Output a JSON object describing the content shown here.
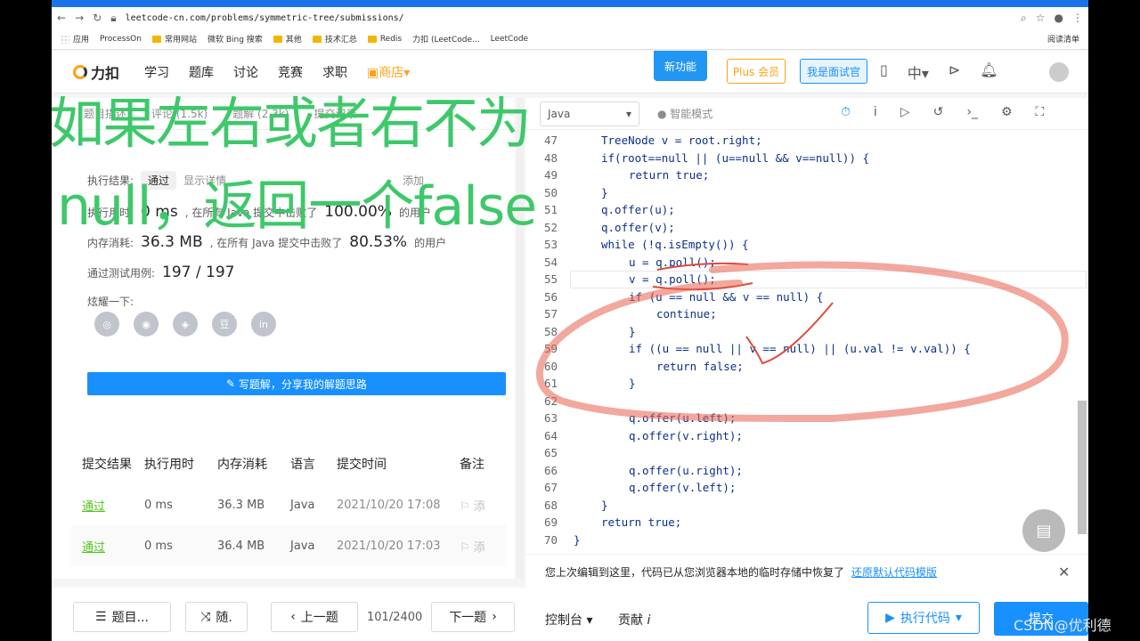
{
  "browser": {
    "url": "leetcode-cn.com/problems/symmetric-tree/submissions/",
    "bookmarks": [
      "应用",
      "ProcessOn",
      "常用网站",
      "微软 Bing 搜索",
      "其他",
      "技术汇总",
      "Redis",
      "力扣 (LeetCode...",
      "LeetCode"
    ],
    "reading_list": "阅读清单"
  },
  "nav": {
    "logo": "力扣",
    "items": [
      "学习",
      "题库",
      "讨论",
      "竞赛",
      "求职"
    ],
    "store": "商店",
    "new_feature": "新功能",
    "plus": "Plus 会员",
    "interviewer": "我是面试官",
    "lang": "中"
  },
  "left": {
    "tabs": [
      "题目描述",
      "评论 (1.5k)",
      "题解 (2.3k)",
      "提交记录"
    ],
    "result_label": "执行结果:",
    "result_value": "通过",
    "show_detail": "显示详情",
    "add_note": "添加",
    "runtime_label": "执行用时:",
    "runtime_value": "0 ms",
    "runtime_text": ", 在所有 Java 提交中击败了",
    "runtime_pct": "100.00%",
    "users": "的用户",
    "memory_label": "内存消耗:",
    "memory_value": "36.3 MB",
    "memory_text": ", 在所有 Java 提交中击败了",
    "memory_pct": "80.53%",
    "cases_label": "通过测试用例:",
    "cases_value": "197 / 197",
    "share_label": "炫耀一下:",
    "share_icons": [
      "wechat-icon",
      "weibo-icon",
      "qq-icon",
      "douban-icon",
      "linkedin-icon"
    ],
    "share_glyphs": [
      "◎",
      "◉",
      "◈",
      "豆",
      "in"
    ],
    "solution_button": "写题解，分享我的解题思路"
  },
  "table": {
    "headers": [
      "提交结果",
      "执行用时",
      "内存消耗",
      "语言",
      "提交时间",
      "备注"
    ],
    "rows": [
      [
        "通过",
        "0 ms",
        "36.3 MB",
        "Java",
        "2021/10/20 17:08",
        "添"
      ],
      [
        "通过",
        "0 ms",
        "36.4 MB",
        "Java",
        "2021/10/20 17:03",
        "添"
      ]
    ]
  },
  "editor": {
    "language": "Java",
    "mode": "智能模式",
    "lines": [
      {
        "n": "47",
        "code": "TreeNode v = root.right;",
        "indent": 1
      },
      {
        "n": "48",
        "code": "if(root==null || (u==null && v==null)) {",
        "indent": 1
      },
      {
        "n": "49",
        "code": "return true;",
        "indent": 2
      },
      {
        "n": "50",
        "code": "}",
        "indent": 1
      },
      {
        "n": "51",
        "code": "q.offer(u);",
        "indent": 1
      },
      {
        "n": "52",
        "code": "q.offer(v);",
        "indent": 1
      },
      {
        "n": "53",
        "code": "while (!q.isEmpty()) {",
        "indent": 1
      },
      {
        "n": "54",
        "code": "u = q.poll();",
        "indent": 2
      },
      {
        "n": "55",
        "code": "v = q.poll();",
        "indent": 2
      },
      {
        "n": "56",
        "code": "if (u == null && v == null) {",
        "indent": 2
      },
      {
        "n": "57",
        "code": "continue;",
        "indent": 3
      },
      {
        "n": "58",
        "code": "}",
        "indent": 2
      },
      {
        "n": "59",
        "code": "if ((u == null || v == null) || (u.val != v.val)) {",
        "indent": 2
      },
      {
        "n": "60",
        "code": "return false;",
        "indent": 3
      },
      {
        "n": "61",
        "code": "}",
        "indent": 2
      },
      {
        "n": "62",
        "code": "",
        "indent": 0
      },
      {
        "n": "63",
        "code": "q.offer(u.left);",
        "indent": 2
      },
      {
        "n": "64",
        "code": "q.offer(v.right);",
        "indent": 2
      },
      {
        "n": "65",
        "code": "",
        "indent": 0
      },
      {
        "n": "66",
        "code": "q.offer(u.right);",
        "indent": 2
      },
      {
        "n": "67",
        "code": "q.offer(v.left);",
        "indent": 2
      },
      {
        "n": "68",
        "code": "}",
        "indent": 1
      },
      {
        "n": "69",
        "code": "return true;",
        "indent": 1
      },
      {
        "n": "70",
        "code": "}",
        "indent": 0
      }
    ],
    "restore_msg": "您上次编辑到这里，代码已从您浏览器本地的临时存储中恢复了",
    "restore_link": "还原默认代码模版"
  },
  "bottom": {
    "problems": "题目...",
    "random": "随.",
    "prev": "上一题",
    "page": "101/2400",
    "next": "下一题",
    "console": "控制台",
    "contribute": "贡献",
    "run": "执行代码",
    "submit": "提交"
  },
  "overlay": {
    "line1": "如果左右或者右不为",
    "line2": "null，返回一个false"
  },
  "watermark": "CSDN@优利德",
  "colors": {
    "accent": "#1890ff",
    "pass": "#52c41a",
    "overlay": "#3ec86a",
    "ink": "#e8604c"
  }
}
